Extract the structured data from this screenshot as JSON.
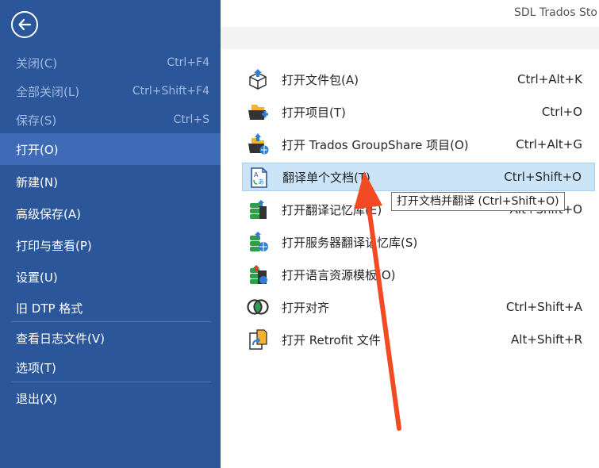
{
  "app_title": "SDL Trados Sto",
  "sidebar": {
    "items": [
      {
        "label": "关闭(C)",
        "shortcut": "Ctrl+F4"
      },
      {
        "label": "全部关闭(L)",
        "shortcut": "Ctrl+Shift+F4"
      },
      {
        "label": "保存(S)",
        "shortcut": "Ctrl+S"
      },
      {
        "label": "打开(O)",
        "shortcut": ""
      },
      {
        "label": "新建(N)",
        "shortcut": ""
      },
      {
        "label": "高级保存(A)",
        "shortcut": ""
      },
      {
        "label": "打印与查看(P)",
        "shortcut": ""
      },
      {
        "label": "设置(U)",
        "shortcut": ""
      },
      {
        "label": "旧 DTP 格式",
        "shortcut": ""
      },
      {
        "label": "查看日志文件(V)",
        "shortcut": ""
      },
      {
        "label": "选项(T)",
        "shortcut": ""
      },
      {
        "label": "退出(X)",
        "shortcut": ""
      }
    ],
    "icons": {
      "back": "back-arrow-icon"
    },
    "colors": {
      "background": "#2b579a",
      "selected": "#3f6ab5",
      "disabled_text": "#a3bade"
    }
  },
  "menu": {
    "items": [
      {
        "label": "打开文件包(A)",
        "shortcut": "Ctrl+Alt+K",
        "icon": "package-open-icon"
      },
      {
        "label": "打开项目(T)",
        "shortcut": "Ctrl+O",
        "icon": "project-folder-icon"
      },
      {
        "label": "打开 Trados GroupShare 项目(O)",
        "shortcut": "Ctrl+Alt+G",
        "icon": "groupshare-project-icon"
      },
      {
        "label": "翻译单个文档(T)",
        "shortcut": "Ctrl+Shift+O",
        "icon": "translate-document-icon"
      },
      {
        "label": "打开翻译记忆库(E)",
        "shortcut": "Alt+Shift+O",
        "icon": "translation-memory-icon"
      },
      {
        "label": "打开服务器翻译记忆库(S)",
        "shortcut": "",
        "icon": "server-translation-memory-icon"
      },
      {
        "label": "打开语言资源模板(O)",
        "shortcut": "",
        "icon": "language-resource-template-icon"
      },
      {
        "label": "打开对齐",
        "shortcut": "Ctrl+Shift+A",
        "icon": "alignment-icon"
      },
      {
        "label": "打开 Retrofit 文件",
        "shortcut": "Alt+Shift+R",
        "icon": "retrofit-file-icon"
      }
    ],
    "colors": {
      "hover_background": "#cce4f7",
      "hover_border": "#a8cfee"
    }
  },
  "tooltip": {
    "text": "打开文档并翻译  (Ctrl+Shift+O)"
  },
  "annotation": {
    "color": "#f24a23",
    "icon": "red-arrow-annotation"
  }
}
